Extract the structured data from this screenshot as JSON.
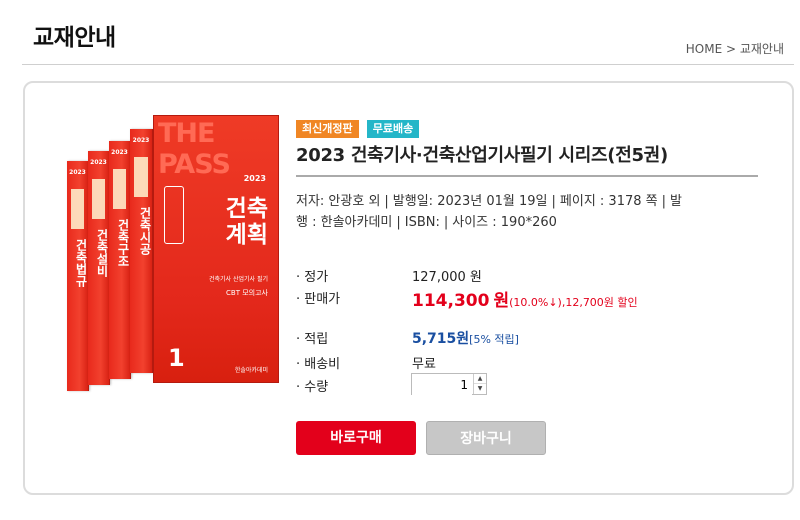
{
  "header": {
    "title": "교재안내",
    "breadcrumb": "HOME > 교재안내"
  },
  "product": {
    "tags": [
      "최신개정판",
      "무료배송"
    ],
    "title": "2023 건축기사·건축산업기사필기 시리즈(전5권)",
    "meta_line1": [
      "저자: 안광호 외",
      "발행일: 2023년 01월 19일",
      "페이지 : 3178 쪽",
      "발"
    ],
    "meta_line2": [
      "행 : 한솔아카데미",
      "ISBN:",
      "사이즈 : 190*260"
    ],
    "list_price_label": "· 정가",
    "list_price": "127,000 원",
    "sale_price_label": "· 판매가",
    "sale_price": "114,300",
    "sale_price_unit": "원",
    "discount": "(10.0%↓),12,700원 할인",
    "points_label": "· 적립",
    "points": "5,715원",
    "points_rate": "[5% 적립]",
    "shipping_label": "· 배송비",
    "shipping": "무료",
    "quantity_label": "· 수량",
    "quantity": "1",
    "buy_button": "바로구매",
    "cart_button": "장바구니"
  },
  "cover": {
    "brand": "THE PASS",
    "year": "2023",
    "front_subject": "건축\n계획",
    "front_line1": "건축기사 산업기사 필기",
    "front_line2": "CBT 모의고사",
    "front_number": "1",
    "publisher": "한솔아카데미",
    "spines": [
      "건축법규",
      "건축설비",
      "건축구조",
      "건축시공"
    ]
  },
  "colors": {
    "accent_red": "#e3001b",
    "points_blue": "#1a4fa1",
    "tag_orange": "#f08624",
    "tag_teal": "#24b6c8",
    "cover_red": "#e8291c"
  }
}
